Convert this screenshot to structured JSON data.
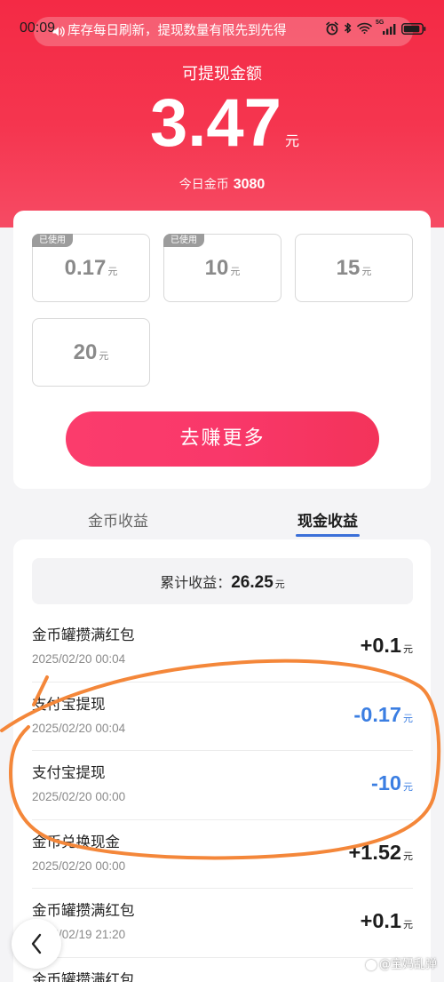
{
  "status_bar": {
    "time": "00:09",
    "network": "5G",
    "battery_level": 0.9
  },
  "notice": {
    "text": "库存每日刷新，提现数量有限先到先得"
  },
  "header": {
    "label": "可提现金额",
    "amount": "3.47",
    "unit": "元",
    "coins_label": "今日金币",
    "coins_value": "3080"
  },
  "withdraw_options": [
    {
      "value": "0.17",
      "unit": "元",
      "badge": "已使用"
    },
    {
      "value": "10",
      "unit": "元",
      "badge": "已使用"
    },
    {
      "value": "15",
      "unit": "元"
    },
    {
      "value": "20",
      "unit": "元"
    }
  ],
  "earn_more_button": {
    "label": "去赚更多"
  },
  "tabs": {
    "active_index": 1,
    "items": [
      {
        "label": "金币收益"
      },
      {
        "label": "现金收益"
      }
    ]
  },
  "summary": {
    "label": "累计收益：",
    "value": "26.25",
    "unit": "元"
  },
  "records": [
    {
      "title": "金币罐攒满红包",
      "time": "2025/02/20 00:04",
      "amount": "+0.1",
      "unit": "元"
    },
    {
      "title": "支付宝提现",
      "time": "2025/02/20 00:04",
      "amount": "-0.17",
      "unit": "元"
    },
    {
      "title": "支付宝提现",
      "time": "2025/02/20 00:00",
      "amount": "-10",
      "unit": "元"
    },
    {
      "title": "金币兑换现金",
      "time": "2025/02/20 00:00",
      "amount": "+1.52",
      "unit": "元"
    },
    {
      "title": "金币罐攒满红包",
      "time": "2025/02/19 21:20",
      "amount": "+0.1",
      "unit": "元"
    },
    {
      "title": "金币罐攒满红包"
    }
  ],
  "watermark": "@宝妈乱弹",
  "icons": [
    "speaker-icon",
    "alarm-icon",
    "bluetooth-icon",
    "wifi-icon",
    "signal-icon",
    "battery-icon",
    "back-chevron-icon"
  ],
  "colors": {
    "header_red": "#f42a45",
    "button_pink": "#f9386a",
    "negative_amount": "#3b7ee2",
    "annotation_orange": "#f4873a",
    "tab_underline": "#3a6fd8"
  }
}
